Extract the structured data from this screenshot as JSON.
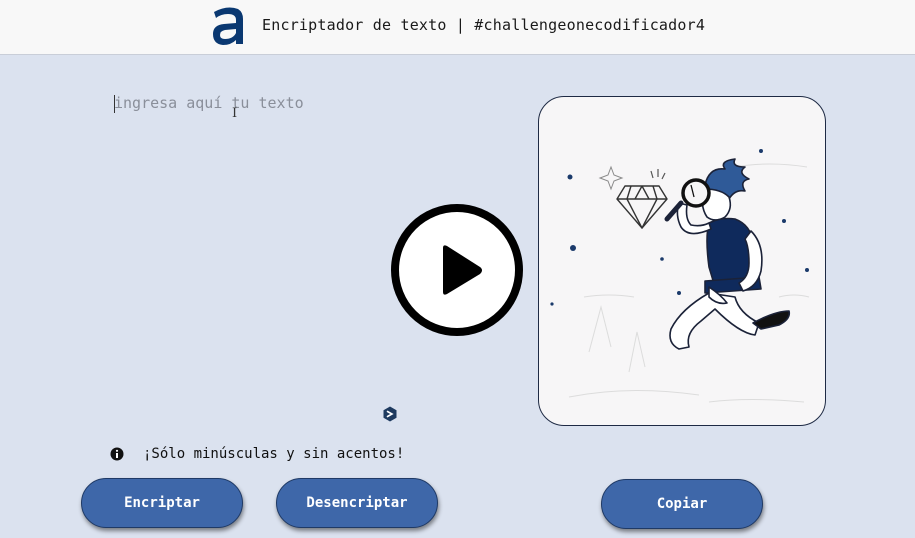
{
  "header": {
    "logo_icon": "alura-a-logo-icon",
    "title": "Encriptador de texto | #challengeonecodificador4"
  },
  "editor": {
    "placeholder": "ingresa aquí tu texto",
    "value": ""
  },
  "overlay": {
    "icon": "play-icon"
  },
  "note": {
    "icon": "info-icon",
    "text": "¡Sólo minúsculas y sin acentos!"
  },
  "buttons": {
    "encrypt_label": "Encriptar",
    "decrypt_label": "Desencriptar",
    "copy_label": "Copiar"
  },
  "result_panel": {
    "illustration": "person-with-magnifying-glass-illustration"
  },
  "colors": {
    "background": "#dbe2ef",
    "header": "#f8f8f8",
    "accent": "#0a3871",
    "button": "#3e67a9",
    "card": "#f7f6f7"
  }
}
